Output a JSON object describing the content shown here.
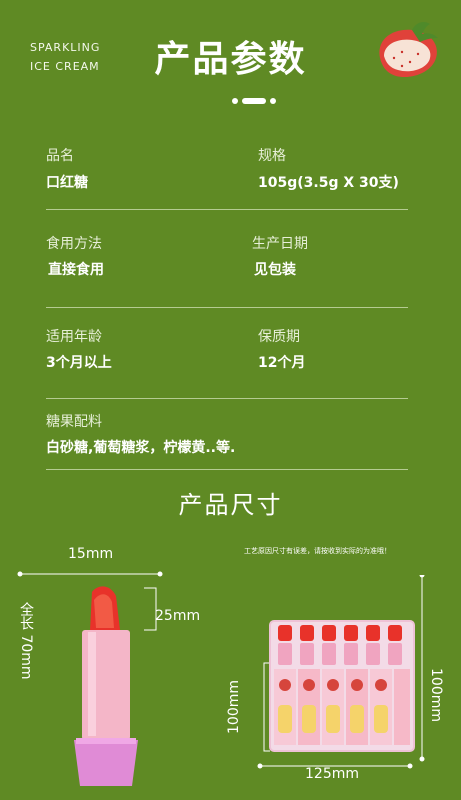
{
  "brand": {
    "line1": "SPARKLING",
    "line2": "ICE CREAM"
  },
  "header": {
    "title": "产品参数"
  },
  "params": {
    "name_label": "品名",
    "name_value": "口红糖",
    "spec_label": "规格",
    "spec_value": "105g(3.5g X 30支)",
    "method_label": "食用方法",
    "method_value": "直接食用",
    "date_label": "生产日期",
    "date_value": "见包装",
    "age_label": "适用年龄",
    "age_value": "3个月以上",
    "shelf_label": "保质期",
    "shelf_value": "12个月",
    "ingredients_label": "糖果配料",
    "ingredients_value": "白砂糖,葡萄糖浆，柠檬黄..等."
  },
  "size_section": {
    "title": "产品尺寸",
    "width_label": "15mm",
    "tip_label": "25mm",
    "length_label": "全长 70mm",
    "box_height_left": "100mm",
    "box_height_right": "100mm",
    "box_width": "125mm",
    "note": "工艺原因尺寸有误差，请按收到实际的为准哦！"
  },
  "colors": {
    "background": "#5f8a24",
    "lipstick_red": "#e8322a",
    "lipstick_tube": "#f4b6c8"
  }
}
